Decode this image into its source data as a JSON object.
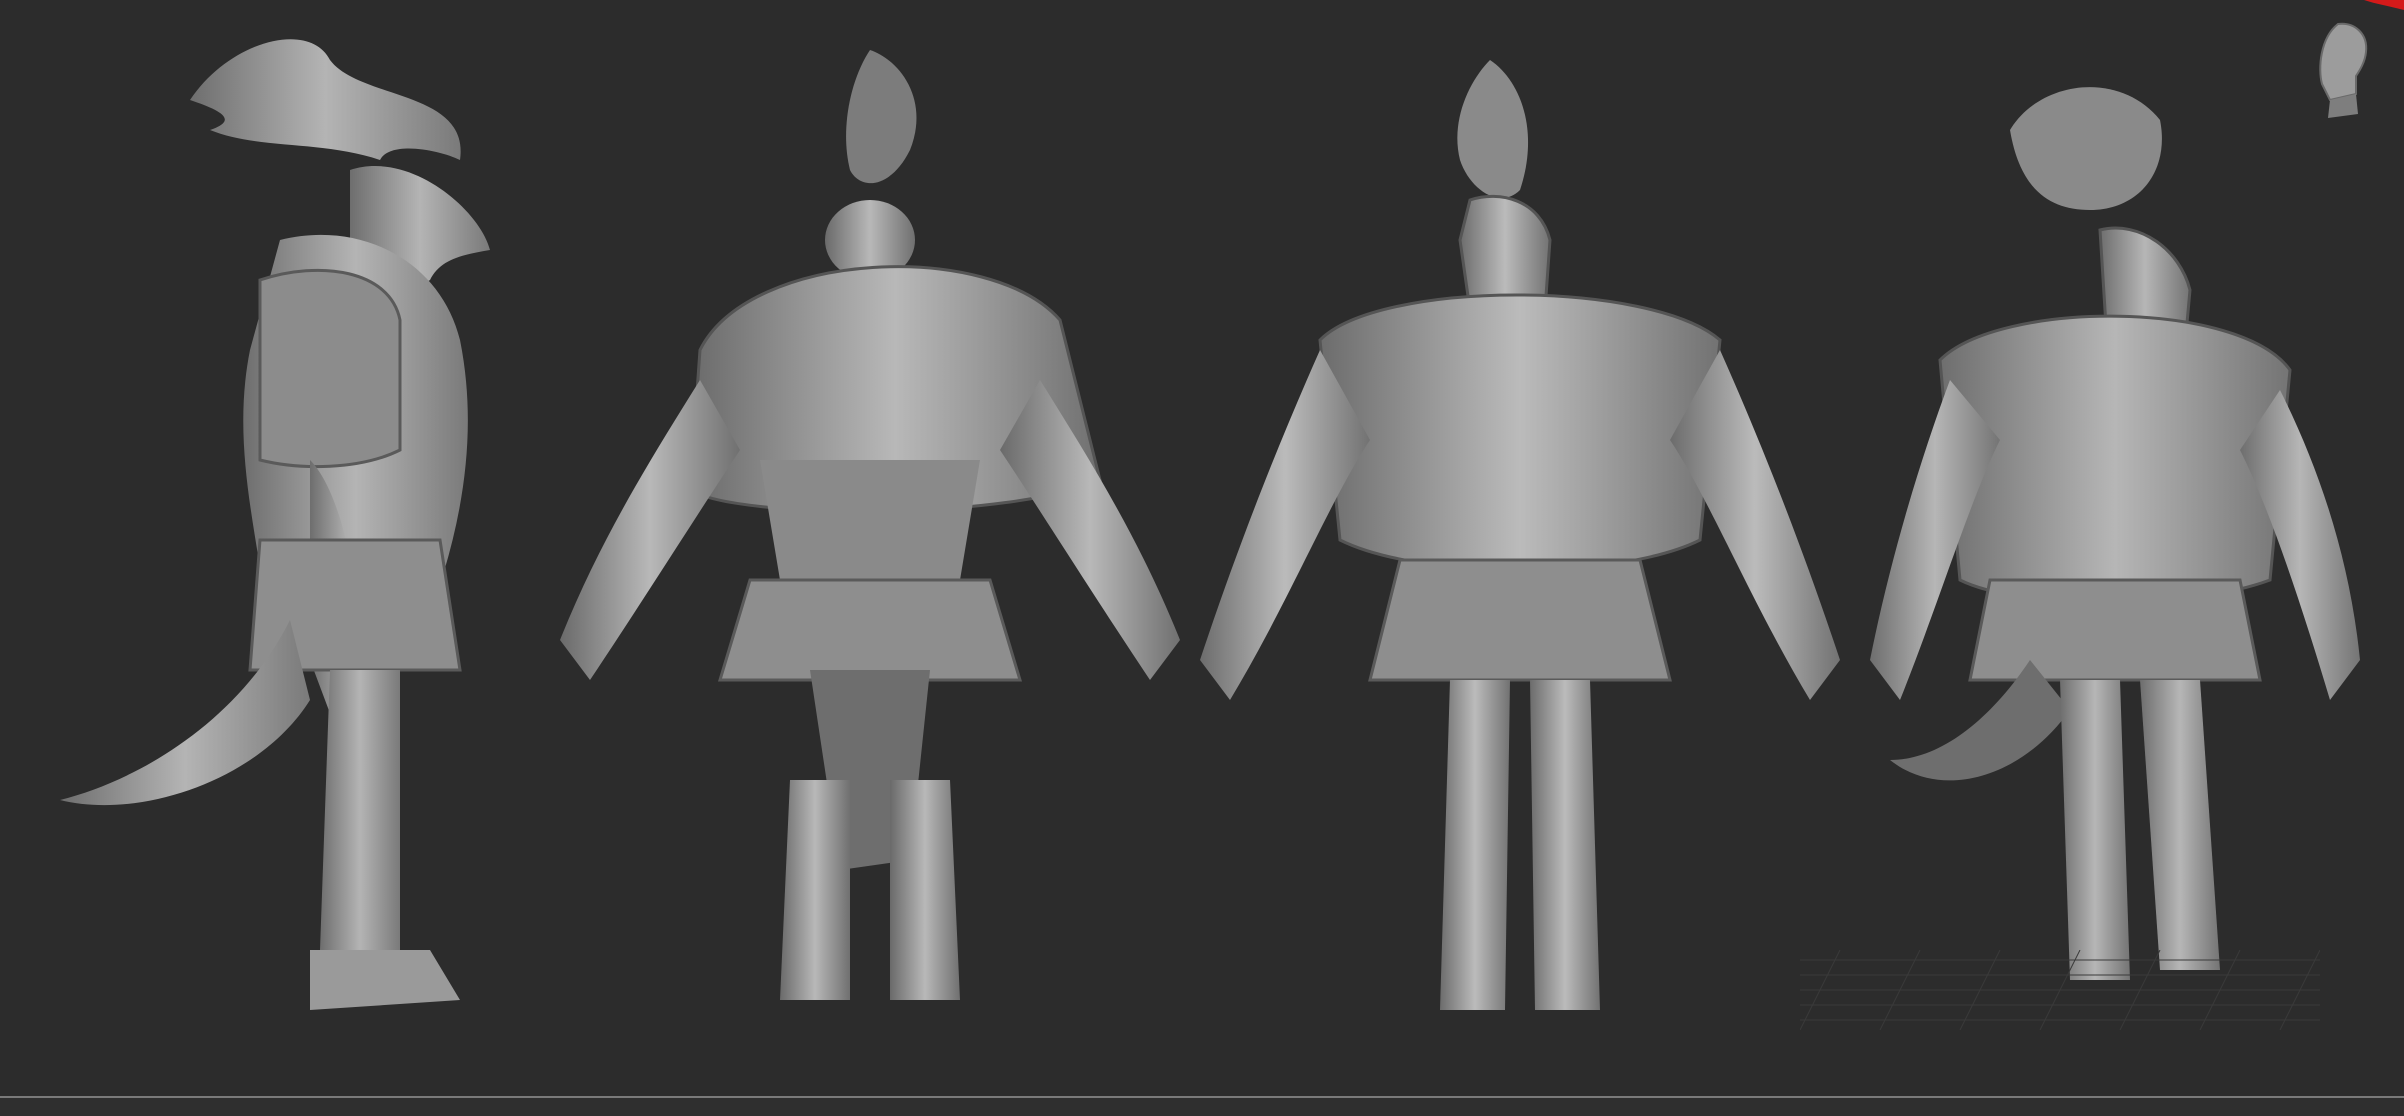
{
  "viewport": {
    "background_color": "#2c2c2c",
    "model_color": "#9a9a9a",
    "model_shadow_color": "#555555",
    "views": [
      {
        "id": "side",
        "icon": "character-side-view"
      },
      {
        "id": "back",
        "icon": "character-back-view"
      },
      {
        "id": "front",
        "icon": "character-front-view"
      },
      {
        "id": "three-quarter",
        "icon": "character-three-quarter-view"
      }
    ]
  },
  "navigation": {
    "icon": "head-orientation-icon"
  },
  "grid": {
    "visible": true,
    "color": "#3a3a3a"
  },
  "accent_color": "#d41a1a"
}
